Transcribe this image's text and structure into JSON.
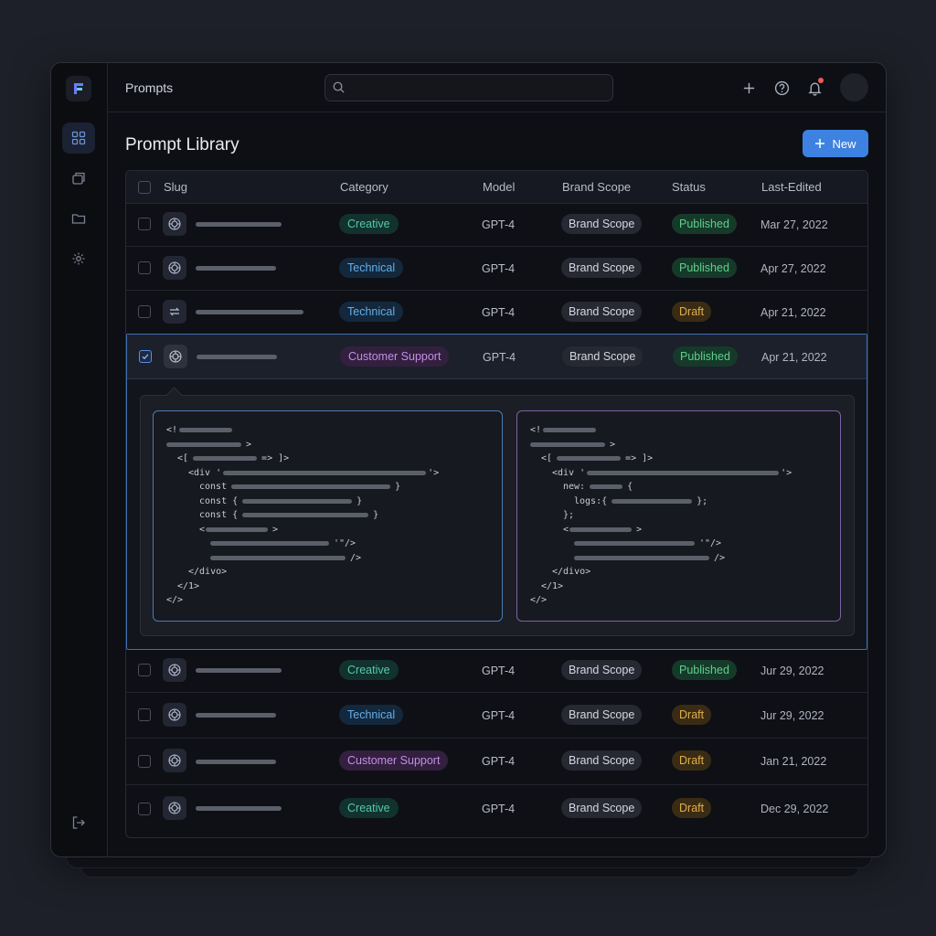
{
  "topbar": {
    "title": "Prompts",
    "search_placeholder": ""
  },
  "page": {
    "title": "Prompt Library",
    "new_button": "New"
  },
  "table": {
    "columns": [
      "Slug",
      "Category",
      "Model",
      "Brand Scope",
      "Status",
      "Last-Edited"
    ],
    "rows": [
      {
        "category": "Creative",
        "model": "GPT-4",
        "scope": "Brand Scope",
        "status": "Published",
        "date": "Mar 27, 2022"
      },
      {
        "category": "Technical",
        "model": "GPT-4",
        "scope": "Brand Scope",
        "status": "Published",
        "date": "Apr 27, 2022"
      },
      {
        "category": "Technical",
        "model": "GPT-4",
        "scope": "Brand Scope",
        "status": "Draft",
        "date": "Apr 21, 2022"
      },
      {
        "category": "Customer Support",
        "model": "GPT-4",
        "scope": "Brand Scope",
        "status": "Published",
        "date": "Apr 21, 2022"
      },
      {
        "category": "Creative",
        "model": "GPT-4",
        "scope": "Brand Scope",
        "status": "Published",
        "date": "Jur 29, 2022"
      },
      {
        "category": "Technical",
        "model": "GPT-4",
        "scope": "Brand Scope",
        "status": "Draft",
        "date": "Jur 29, 2022"
      },
      {
        "category": "Customer Support",
        "model": "GPT-4",
        "scope": "Brand Scope",
        "status": "Draft",
        "date": "Jan 21, 2022"
      },
      {
        "category": "Creative",
        "model": "GPT-4",
        "scope": "Brand Scope",
        "status": "Draft",
        "date": "Dec 29, 2022"
      }
    ]
  },
  "code_left": {
    "l1": "<!",
    "l2": ">",
    "l3a": "<[",
    "l3b": "=> ]>",
    "l4a": "<div '",
    "l4b": "'>",
    "l5a": "const",
    "l5b": "}",
    "l6a": "const {",
    "l6b": "}",
    "l7a": "const {",
    "l7b": "}",
    "l8a": "<",
    "l8b": ">",
    "l9": "'\"/>",
    "l10": "/>",
    "l11": "</divo>",
    "l12": "</1>",
    "l13": "</>"
  },
  "code_right": {
    "l1": "<!",
    "l2": ">",
    "l3a": "<[",
    "l3b": "=> ]>",
    "l4a": "<div '",
    "l4b": "'>",
    "l5a": "new:",
    "l5b": "{",
    "l6a": "logs:{",
    "l6b": "};",
    "l7": "};",
    "l8a": "<",
    "l8b": ">",
    "l9": "'\"/>",
    "l10": "/>",
    "l11": "</divo>",
    "l12": "</1>",
    "l13": "</>"
  },
  "colors": {
    "accent": "#3d82e0",
    "creative": "#2f9e86",
    "technical": "#4a9fe0",
    "support": "#b37bd9",
    "published": "#3cba73",
    "draft": "#d9a441"
  },
  "icons": [
    "logo-icon",
    "grid-icon",
    "layers-icon",
    "folder-icon",
    "settings-icon",
    "logout-icon",
    "search-icon",
    "plus-icon",
    "help-icon",
    "bell-icon",
    "openai-icon",
    "shuffle-icon",
    "check-icon"
  ]
}
